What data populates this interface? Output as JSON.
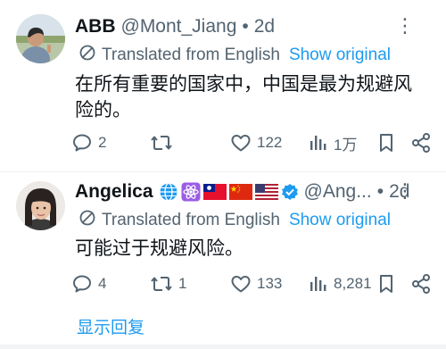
{
  "tweets": [
    {
      "name": "ABB",
      "handle": "@Mont_Jiang",
      "sep": "•",
      "time": "2d",
      "translated_label": "Translated from English",
      "show_original": "Show original",
      "text": "在所有重要的国家中，中国是最为规避风险的。",
      "actions": {
        "replies": "2",
        "reposts": "",
        "likes": "122",
        "views": "1万"
      }
    },
    {
      "name": "Angelica",
      "handle": "@Ang...",
      "sep": "•",
      "time": "2d",
      "verified": true,
      "name_emojis": [
        "globe-icon",
        "atom-icon",
        "taiwan-flag",
        "china-flag",
        "usa-flag"
      ],
      "translated_label": "Translated from English",
      "show_original": "Show original",
      "text": "可能过于规避风险。",
      "actions": {
        "replies": "4",
        "reposts": "1",
        "likes": "133",
        "views": "8,281"
      }
    }
  ],
  "show_replies": "显示回复",
  "colors": {
    "accent": "#1d9bf0",
    "secondary": "#536471",
    "text": "#0f1419"
  }
}
